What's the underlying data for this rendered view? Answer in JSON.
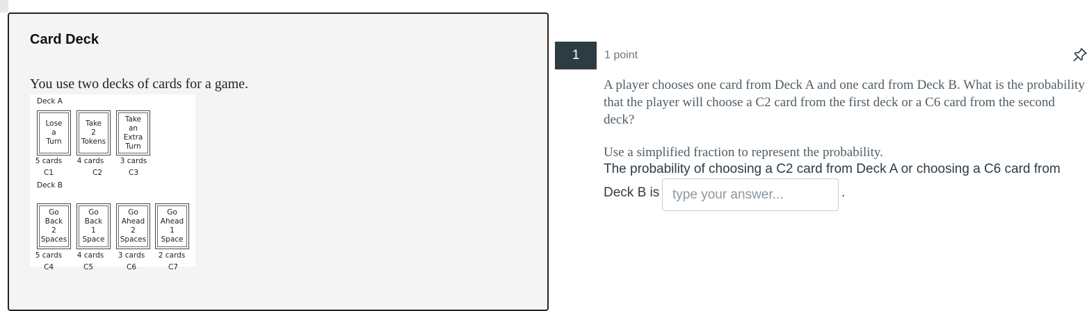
{
  "stimulus": {
    "title": "Card Deck",
    "intro": "You use two decks of cards for a game.",
    "deck_a": {
      "label": "Deck A",
      "cards": [
        {
          "text": "Lose\na\nTurn",
          "count": "5 cards",
          "code": "C1"
        },
        {
          "text": "Take\n2\nTokens",
          "count": "4 cards",
          "code": "C2"
        },
        {
          "text": "Take\nan\nExtra\nTurn",
          "count": "3 cards",
          "code": "C3"
        }
      ]
    },
    "deck_b": {
      "label": "Deck B",
      "cards": [
        {
          "text": "Go\nBack\n2\nSpaces",
          "count": "5 cards",
          "code": "C4"
        },
        {
          "text": "Go\nBack\n1\nSpace",
          "count": "4 cards",
          "code": "C5"
        },
        {
          "text": "Go\nAhead\n2\nSpaces",
          "count": "3 cards",
          "code": "C6"
        },
        {
          "text": "Go\nAhead\n1\nSpace",
          "count": "2 cards",
          "code": "C7"
        }
      ]
    }
  },
  "question": {
    "number": "1",
    "points": "1 point",
    "text": "A player chooses one card from Deck A and one card from Deck B. What is the probability that the player will choose a C2 card from the first deck or a C6 card from the second deck?",
    "instruction": "Use a simplified fraction to represent the probability.",
    "answer_prefix_line1": "The probability of choosing a C2 card from Deck A or choosing a C6 card from",
    "answer_prefix_line2": "Deck B is",
    "answer_placeholder": "type your answer...",
    "answer_value": "",
    "answer_suffix": ".",
    "pin_icon": "pin-icon"
  }
}
